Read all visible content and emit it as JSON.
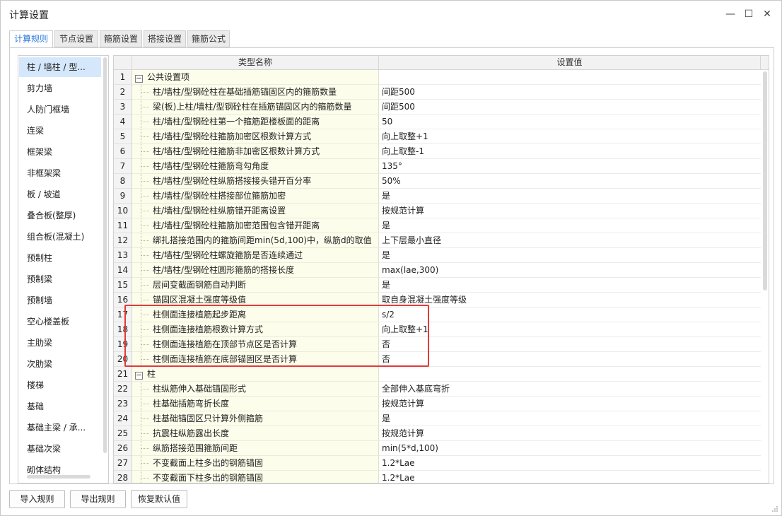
{
  "window": {
    "title": "计算设置",
    "minimize_glyph": "—",
    "maximize_glyph": "☐",
    "close_glyph": "✕"
  },
  "tabs": [
    {
      "label": "计算规则",
      "active": true
    },
    {
      "label": "节点设置"
    },
    {
      "label": "箍筋设置"
    },
    {
      "label": "搭接设置"
    },
    {
      "label": "箍筋公式"
    }
  ],
  "sidebar": {
    "items": [
      {
        "label": "柱 / 墙柱 / 型...",
        "active": true
      },
      {
        "label": "剪力墙"
      },
      {
        "label": "人防门框墙"
      },
      {
        "label": "连梁"
      },
      {
        "label": "框架梁"
      },
      {
        "label": "非框架梁"
      },
      {
        "label": "板 / 坡道"
      },
      {
        "label": "叠合板(整厚)"
      },
      {
        "label": "组合板(混凝土)"
      },
      {
        "label": "预制柱"
      },
      {
        "label": "预制梁"
      },
      {
        "label": "预制墙"
      },
      {
        "label": "空心楼盖板"
      },
      {
        "label": "主肋梁"
      },
      {
        "label": "次肋梁"
      },
      {
        "label": "楼梯"
      },
      {
        "label": "基础"
      },
      {
        "label": "基础主梁 / 承..."
      },
      {
        "label": "基础次梁"
      },
      {
        "label": "砌体结构"
      }
    ]
  },
  "table": {
    "columns": {
      "name": "类型名称",
      "value": "设置值"
    },
    "rows": [
      {
        "num": "1",
        "name": "公共设置项",
        "value": "",
        "group": true
      },
      {
        "num": "2",
        "name": "柱/墙柱/型钢砼柱在基础插筋锚固区内的箍筋数量",
        "value": "间距500"
      },
      {
        "num": "3",
        "name": "梁(板)上柱/墙柱/型钢砼柱在插筋锚固区内的箍筋数量",
        "value": "间距500"
      },
      {
        "num": "4",
        "name": "柱/墙柱/型钢砼柱第一个箍筋距楼板面的距离",
        "value": "50"
      },
      {
        "num": "5",
        "name": "柱/墙柱/型钢砼柱箍筋加密区根数计算方式",
        "value": "向上取整+1"
      },
      {
        "num": "6",
        "name": "柱/墙柱/型钢砼柱箍筋非加密区根数计算方式",
        "value": "向上取整-1"
      },
      {
        "num": "7",
        "name": "柱/墙柱/型钢砼柱箍筋弯勾角度",
        "value": "135°"
      },
      {
        "num": "8",
        "name": "柱/墙柱/型钢砼柱纵筋搭接接头错开百分率",
        "value": "50%"
      },
      {
        "num": "9",
        "name": "柱/墙柱/型钢砼柱搭接部位箍筋加密",
        "value": "是"
      },
      {
        "num": "10",
        "name": "柱/墙柱/型钢砼柱纵筋错开距离设置",
        "value": "按规范计算"
      },
      {
        "num": "11",
        "name": "柱/墙柱/型钢砼柱箍筋加密范围包含错开距离",
        "value": "是"
      },
      {
        "num": "12",
        "name": "绑扎搭接范围内的箍筋间距min(5d,100)中，纵筋d的取值",
        "value": "上下层最小直径"
      },
      {
        "num": "13",
        "name": "柱/墙柱/型钢砼柱螺旋箍筋是否连续通过",
        "value": "是"
      },
      {
        "num": "14",
        "name": "柱/墙柱/型钢砼柱圆形箍筋的搭接长度",
        "value": "max(lae,300)"
      },
      {
        "num": "15",
        "name": "层间变截面钢筋自动判断",
        "value": "是"
      },
      {
        "num": "16",
        "name": "锚固区混凝土强度等级值",
        "value": "取自身混凝土强度等级"
      },
      {
        "num": "17",
        "name": "柱侧面连接植筋起步距离",
        "value": "s/2"
      },
      {
        "num": "18",
        "name": "柱侧面连接植筋根数计算方式",
        "value": "向上取整+1"
      },
      {
        "num": "19",
        "name": "柱侧面连接植筋在顶部节点区是否计算",
        "value": "否"
      },
      {
        "num": "20",
        "name": "柱侧面连接植筋在底部锚固区是否计算",
        "value": "否"
      },
      {
        "num": "21",
        "name": "柱",
        "value": "",
        "group": true
      },
      {
        "num": "22",
        "name": "柱纵筋伸入基础锚固形式",
        "value": "全部伸入基底弯折"
      },
      {
        "num": "23",
        "name": "柱基础插筋弯折长度",
        "value": "按规范计算"
      },
      {
        "num": "24",
        "name": "柱基础锚固区只计算外侧箍筋",
        "value": "是"
      },
      {
        "num": "25",
        "name": "抗震柱纵筋露出长度",
        "value": "按规范计算"
      },
      {
        "num": "26",
        "name": "纵筋搭接范围箍筋间距",
        "value": "min(5*d,100)"
      },
      {
        "num": "27",
        "name": "不变截面上柱多出的钢筋锚固",
        "value": "1.2*Lae"
      },
      {
        "num": "28",
        "name": "不变截面下柱多出的钢筋锚固",
        "value": "1.2*Lae"
      }
    ]
  },
  "footer": {
    "import_label": "导入规则",
    "export_label": "导出规则",
    "restore_label": "恢复默认值"
  },
  "colors": {
    "accent": "#2a7ad8",
    "highlight_box": "#e23a3a",
    "name_cell_bg": "#fdfdeb",
    "selected_item_bg": "#d5e8fb"
  }
}
